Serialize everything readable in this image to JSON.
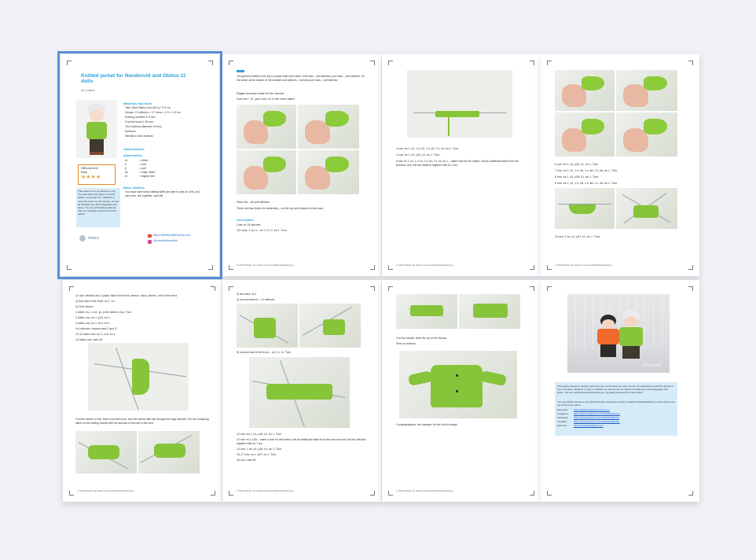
{
  "cover": {
    "title": "Knitted jacket for Nendoroid and Obitsu 11 dolls",
    "subtitle": "Art & pattern",
    "materials_heading": "Materials and tools",
    "materials": [
      "Yarn: Alize Baby wool (50 g / 175 m)",
      "Gauge: 10 stitches × 17 rows = 1.5 × 1.5 cm",
      "Knitting needles 1.5 mm",
      "Crochet hook 1.25 mm",
      "Two buttons (diameter 5 mm)",
      "Scissors",
      "Needle to sew buttons"
    ],
    "abbrev_heading": "Abbreviations",
    "abbrev_sub": "Abbreviations",
    "abbreviations": [
      [
        "st",
        "= stitch"
      ],
      [
        "k",
        "= knit"
      ],
      [
        "p",
        "= purl"
      ],
      [
        "es",
        "= edge stitch"
      ],
      [
        "rs",
        "= raglan line"
      ]
    ],
    "difficulty_label": "Difficulty level",
    "difficulty_value": "Easy",
    "stars": "★★★★",
    "basic_heading": "Basic stitches",
    "basic_text": "You must have basic knitting skills (be able to cast on, knit, purl, yarn over, knit together, cast off).",
    "notice": "This pattern is for personal use only. You don't have the rights to sell this pattern or any part of it, distribute it, copy and post it on the internet, as well as translate into other languages and share. You can sell finished products that you manually produced from this pattern.",
    "logo": "Pattern",
    "contact_email": "https://WhiteDollsFactory.com",
    "contact_ig": "@ohmydollspattern"
  },
  "p2": {
    "intro": "The jacket is knitted from top to bottom with front stitch. Knit rows – knit stitches, purl rows – purl stitches. On the collar, at the bottom of the sweater and sleeves – knit and purl rows – knit stitches.",
    "raglan": "Raglan increase made for the sleeves:",
    "formula": "*knit row + k1, yarn over, k1 in the same stitch*",
    "after": "Next row – all purl stitches.",
    "note": "There are two holes for fastening – on the top and bottom of the rows.",
    "section": "Description",
    "cast": "Cast on 18 stitches",
    "row1": "1/3 rows: 1 es, k – es 1, k 17, es 1. Turn."
  },
  "p3": {
    "rows": [
      "3 row: es 1, k1, 1 k, k2, 1 k, k2, 1 k, k2, es 1. Turn.",
      "4 row: es 1, k1, p22, k1, es 1. Turn.",
      "5 row: es 1, k1, 1 k, k4, 1 k, k4, 1 k, k4, es 1 – make hole for the button, knit an additional stitch from the previous row, knit two stitches together with es. Turn."
    ]
  },
  "p4": {
    "rows": [
      "6 row: es 1, k1, p32, k1, es 1. Turn.",
      "7 row: es 1, k1, 1 k, k6, 1 k, k6, 1 k, k6, es 1. Turn.",
      "8 row: es 1, k1, p38, k1, es 1. Turn.",
      "9 row: es 1, k1, 1 k, k8, 1 k, k8, 1 k, k8, es 1. Turn."
    ],
    "last": "10 row: 1 es, k1, p47, k1, es 1. Turn."
  },
  "p5": {
    "lines": [
      "11 row: divided into 3 parts: half of the front, sleeve, back, sleeve, half of the front.",
      "1) first half of the front: es 1, 10.",
      "2) First sleeve:",
      "1 stitch: es 1, k11, p1 (12th stitch is es). Turn.",
      "2 stitch row: es 1, p10, es 1.",
      "3 stitch row: es 1, k10, es 1.",
      "4-6 stitches: repeat rows 2 and 3.",
      "10-12 stitch row: es 1, k10, es 1.",
      "13 stitch row: cast off."
    ],
    "after": "Fold the sleeve in half. With a crochet hook, sew the sleeve with slip through the edge stitches. Put the remaining stitch on the knitting needle with the stitches of the half of the front."
  },
  "p6": {
    "l1": "3) the back: k11",
    "l2": "4) second sleeve = 11 stitches.",
    "l3": "5) second half of the front – es 1, k 11. Turn.",
    "rows": [
      "12 row: es 1, k1, p28, k1, es 1. Turn.",
      "13 row: es 1, k28 – make a hole for the button, knit an additional stitch from the previous row, knit two stitches together with es. Turn.",
      "14 row: 1 es, k1, p28, k1, es 1. Turn.",
      "15-17 row: es 1, k27, es 1. Turn.",
      "18 row: cast off."
    ]
  },
  "p7": {
    "l1": "Cut the thread. Hide the tip of the thread.",
    "l2": "Sew on buttons.",
    "l3": "Congratulations, the sweater for the doll is ready!"
  },
  "p8": {
    "watermark": "White Dolls",
    "box_text": "This tutorial should be used for personal (not commercial) use only. You are not authorized to sell this tutorial or any of its parts, distribute it, copy or publish it on the internet, as well as translate into other languages and share. You can sell finished products that you manually produced from this tutorial.",
    "box_text2": "You can publish photos of your finished works, but please do link or indicate WhiteDollsFactory as the author and put a link to the author.",
    "links": [
      [
        "Etsy shop:",
        "https://WhiteDollsFactory.etsy.com"
      ],
      [
        "Instagram:",
        "https://www.instagram.com/whitedollsfactory"
      ],
      [
        "Facebook:",
        "https://www.facebook.com/whitedollsfactory"
      ],
      [
        "YouTube:",
        "https://www.youtube.com/c/whitedollsfactory"
      ],
      [
        "Web site:",
        "https://whitedollsfactory.com"
      ]
    ]
  },
  "footer": "© 2023 Pattern for dolls by Ksenia (WhiteDollsFactory)"
}
